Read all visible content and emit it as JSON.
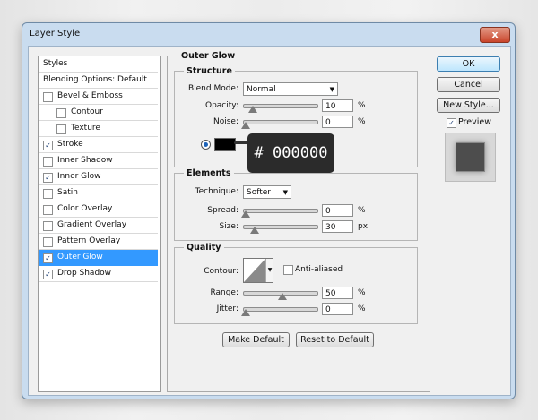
{
  "window": {
    "title": "Layer Style",
    "close_glyph": "x"
  },
  "styles_list": {
    "header": "Styles",
    "blending": "Blending Options: Default",
    "items": [
      {
        "label": "Bevel & Emboss",
        "checked": false,
        "indent": false
      },
      {
        "label": "Contour",
        "checked": false,
        "indent": true
      },
      {
        "label": "Texture",
        "checked": false,
        "indent": true
      },
      {
        "label": "Stroke",
        "checked": true,
        "indent": false
      },
      {
        "label": "Inner Shadow",
        "checked": false,
        "indent": false
      },
      {
        "label": "Inner Glow",
        "checked": true,
        "indent": false
      },
      {
        "label": "Satin",
        "checked": false,
        "indent": false
      },
      {
        "label": "Color Overlay",
        "checked": false,
        "indent": false
      },
      {
        "label": "Gradient Overlay",
        "checked": false,
        "indent": false
      },
      {
        "label": "Pattern Overlay",
        "checked": false,
        "indent": false
      },
      {
        "label": "Outer Glow",
        "checked": true,
        "indent": false,
        "selected": true
      },
      {
        "label": "Drop Shadow",
        "checked": true,
        "indent": false
      }
    ]
  },
  "outer_glow": {
    "title": "Outer Glow",
    "structure": {
      "title": "Structure",
      "blend_mode_label": "Blend Mode:",
      "blend_mode": "Normal",
      "opacity_label": "Opacity:",
      "opacity": "10",
      "opacity_unit": "%",
      "opacity_fraction": 0.1,
      "noise_label": "Noise:",
      "noise": "0",
      "noise_unit": "%",
      "noise_fraction": 0.0,
      "color": "#000000"
    },
    "elements": {
      "title": "Elements",
      "technique_label": "Technique:",
      "technique": "Softer",
      "spread_label": "Spread:",
      "spread": "0",
      "spread_unit": "%",
      "spread_fraction": 0.0,
      "size_label": "Size:",
      "size": "30",
      "size_unit": "px",
      "size_fraction": 0.12
    },
    "quality": {
      "title": "Quality",
      "contour_label": "Contour:",
      "anti_aliased_label": "Anti-aliased",
      "anti_aliased": false,
      "range_label": "Range:",
      "range": "50",
      "range_unit": "%",
      "range_fraction": 0.5,
      "jitter_label": "Jitter:",
      "jitter": "0",
      "jitter_unit": "%",
      "jitter_fraction": 0.0
    },
    "make_default": "Make Default",
    "reset_default": "Reset to Default"
  },
  "buttons": {
    "ok": "OK",
    "cancel": "Cancel",
    "new_style": "New Style..."
  },
  "preview": {
    "label": "Preview",
    "checked": true
  },
  "tooltip": {
    "text": "# 000000"
  },
  "colors": {
    "accent": "#3399ff",
    "tooltip_bg": "#2b2b2b"
  }
}
